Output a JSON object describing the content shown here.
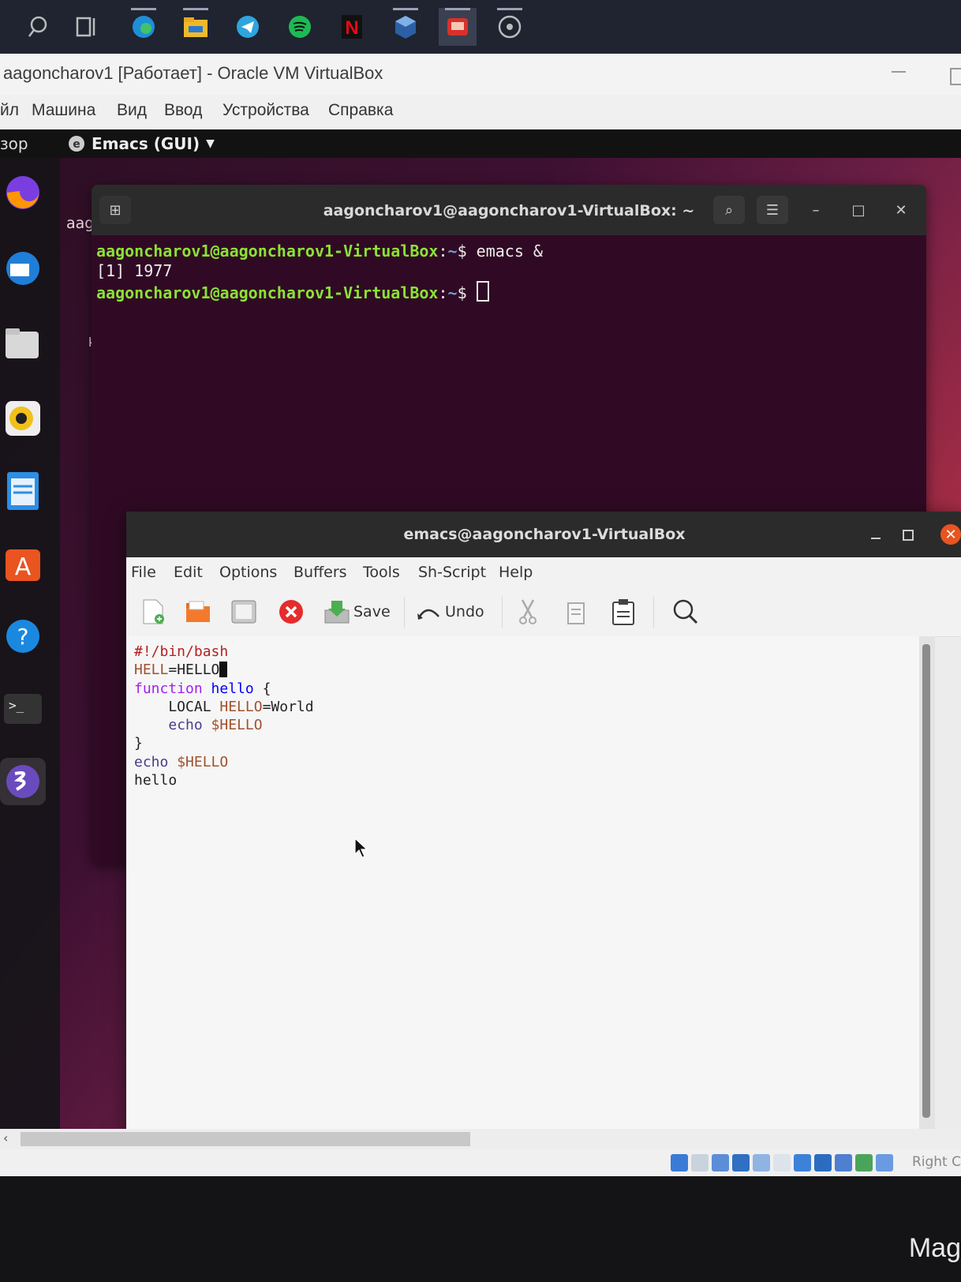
{
  "host_taskbar": {
    "icons": [
      "search-icon",
      "task-view-icon",
      "edge-icon",
      "explorer-icon",
      "telegram-icon",
      "spotify-icon",
      "netflix-icon",
      "virtualbox-icon",
      "app-icon",
      "app2-icon"
    ]
  },
  "vbox": {
    "title": "aagoncharov1 [Работает] - Oracle VM VirtualBox",
    "menu": [
      "йл",
      "Машина",
      "Вид",
      "Ввод",
      "Устройства",
      "Справка"
    ],
    "host_key": "Right C"
  },
  "gnome": {
    "activities": "зор",
    "app_menu": "Emacs (GUI)",
    "desktop_label": "aag",
    "desktop_label_k": "k"
  },
  "terminal": {
    "title": "aagoncharov1@aagoncharov1-VirtualBox: ~",
    "lines": [
      {
        "user": "aagoncharov1@aagoncharov1-VirtualBox",
        "path": "~",
        "cmd": " emacs &"
      },
      {
        "text": "[1] 1977"
      },
      {
        "user": "aagoncharov1@aagoncharov1-VirtualBox",
        "path": "~",
        "cmd": " "
      }
    ]
  },
  "emacs": {
    "title": "emacs@aagoncharov1-VirtualBox",
    "menu": [
      "File",
      "Edit",
      "Options",
      "Buffers",
      "Tools",
      "Sh-Script",
      "Help"
    ],
    "toolbar": {
      "save": "Save",
      "undo": "Undo"
    },
    "code": {
      "l1": "#!/bin/bash",
      "l2_var": "HELL",
      "l2_val": "=HELLO",
      "l3_kw": "function",
      "l3_fn": "hello",
      "l3_rest": " {",
      "l4_indent": "    LOCAL ",
      "l4_var": "HELLO",
      "l4_val": "=World",
      "l5_indent": "    ",
      "l5_cmd": "echo",
      "l5_var": " $HELLO",
      "l6": "}",
      "l7_cmd": "echo",
      "l7_var": " $HELLO",
      "l8": "hello"
    }
  },
  "bezel": {
    "brand": "Mag"
  },
  "colors": {
    "ubuntu_orange": "#e95420",
    "terminal_bg": "#300a24",
    "prompt_green": "#8ae234",
    "prompt_blue": "#729fcf"
  }
}
